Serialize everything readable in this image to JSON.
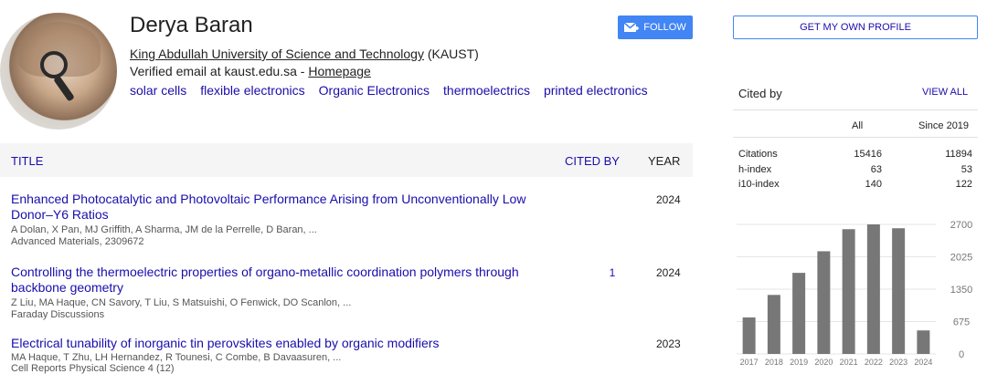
{
  "profile": {
    "name": "Derya Baran",
    "affiliation_link": "King Abdullah University of Science and Technology",
    "affiliation_suffix": " (KAUST)",
    "verified_prefix": "Verified email at kaust.edu.sa - ",
    "homepage": "Homepage",
    "interests": [
      "solar cells",
      "flexible electronics",
      "Organic Electronics",
      "thermoelectrics",
      "printed electronics"
    ],
    "follow_label": "FOLLOW"
  },
  "table": {
    "headers": {
      "title": "TITLE",
      "cited_by": "CITED BY",
      "year": "YEAR"
    },
    "rows": [
      {
        "title": "Enhanced Photocatalytic and Photovoltaic Performance Arising from Unconventionally Low Donor–Y6 Ratios",
        "authors": "A Dolan, X Pan, MJ Griffith, A Sharma, JM de la Perrelle, D Baran, ...",
        "venue": "Advanced Materials, 2309672",
        "cited_by": "",
        "year": "2024"
      },
      {
        "title": "Controlling the thermoelectric properties of organo-metallic coordination polymers through backbone geometry",
        "authors": "Z Liu, MA Haque, CN Savory, T Liu, S Matsuishi, O Fenwick, DO Scanlon, ...",
        "venue": "Faraday Discussions",
        "cited_by": "1",
        "year": "2024"
      },
      {
        "title": "Electrical tunability of inorganic tin perovskites enabled by organic modifiers",
        "authors": "MA Haque, T Zhu, LH Hernandez, R Tounesi, C Combe, B Davaasuren, ...",
        "venue": "Cell Reports Physical Science 4 (12)",
        "cited_by": "",
        "year": "2023"
      }
    ]
  },
  "sidebar": {
    "get_profile_label": "GET MY OWN PROFILE",
    "cited_by_label": "Cited by",
    "view_all_label": "VIEW ALL",
    "col_all": "All",
    "col_since": "Since 2019",
    "stats": [
      {
        "label": "Citations",
        "all": "15416",
        "since": "11894"
      },
      {
        "label": "h-index",
        "all": "63",
        "since": "53"
      },
      {
        "label": "i10-index",
        "all": "140",
        "since": "122"
      }
    ]
  },
  "chart_data": {
    "type": "bar",
    "categories": [
      "2017",
      "2018",
      "2019",
      "2020",
      "2021",
      "2022",
      "2023",
      "2024"
    ],
    "values": [
      760,
      1230,
      1690,
      2140,
      2600,
      2700,
      2620,
      490
    ],
    "yticks": [
      0,
      675,
      1350,
      2025,
      2700
    ],
    "ylim": [
      0,
      2700
    ],
    "color": "#777777"
  }
}
